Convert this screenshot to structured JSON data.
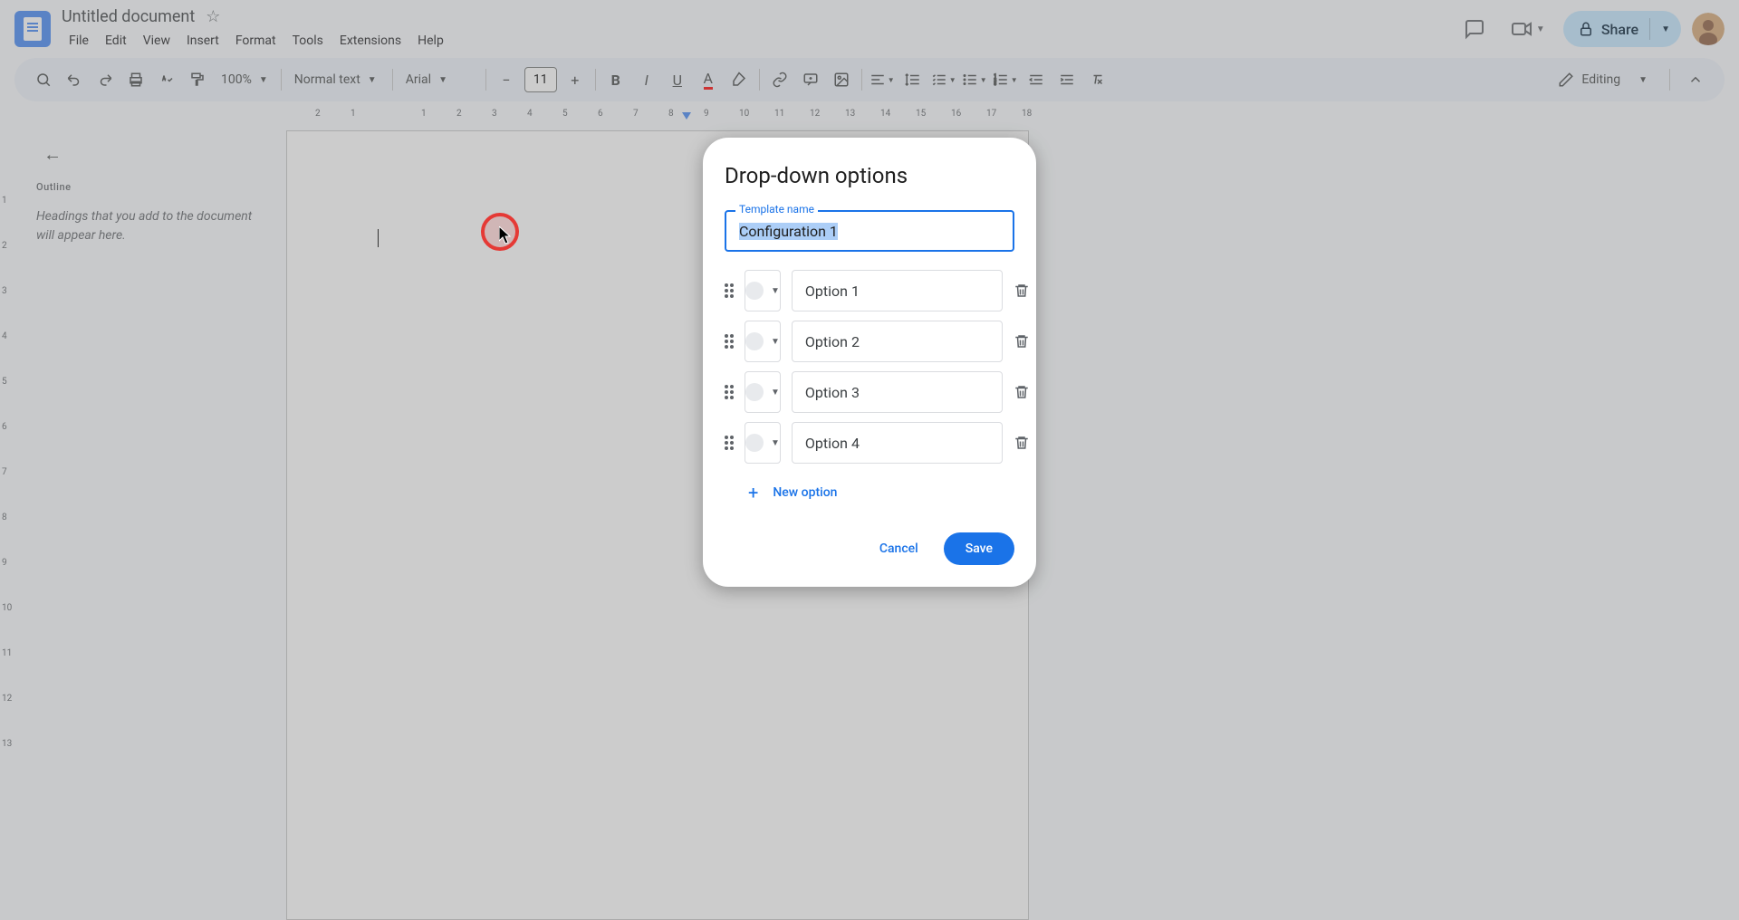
{
  "header": {
    "title": "Untitled document",
    "menus": [
      "File",
      "Edit",
      "View",
      "Insert",
      "Format",
      "Tools",
      "Extensions",
      "Help"
    ],
    "share_label": "Share"
  },
  "toolbar": {
    "zoom": "100%",
    "style": "Normal text",
    "font": "Arial",
    "font_size": "11",
    "mode": "Editing"
  },
  "ruler_h": [
    "2",
    "1",
    "",
    "1",
    "2",
    "3",
    "4",
    "5",
    "6",
    "7",
    "8",
    "9",
    "10",
    "11",
    "12",
    "13",
    "14",
    "15",
    "16",
    "17",
    "18"
  ],
  "ruler_v": [
    "",
    "1",
    "2",
    "3",
    "4",
    "5",
    "6",
    "7",
    "8",
    "9",
    "10",
    "11",
    "12",
    "13"
  ],
  "outline": {
    "title": "Outline",
    "placeholder": "Headings that you add to the document will appear here."
  },
  "dialog": {
    "title": "Drop-down options",
    "template_label": "Template name",
    "template_value": "Configuration 1",
    "options": [
      {
        "label": "Option 1"
      },
      {
        "label": "Option 2"
      },
      {
        "label": "Option 3"
      },
      {
        "label": "Option 4"
      }
    ],
    "new_option": "New option",
    "cancel": "Cancel",
    "save": "Save"
  }
}
